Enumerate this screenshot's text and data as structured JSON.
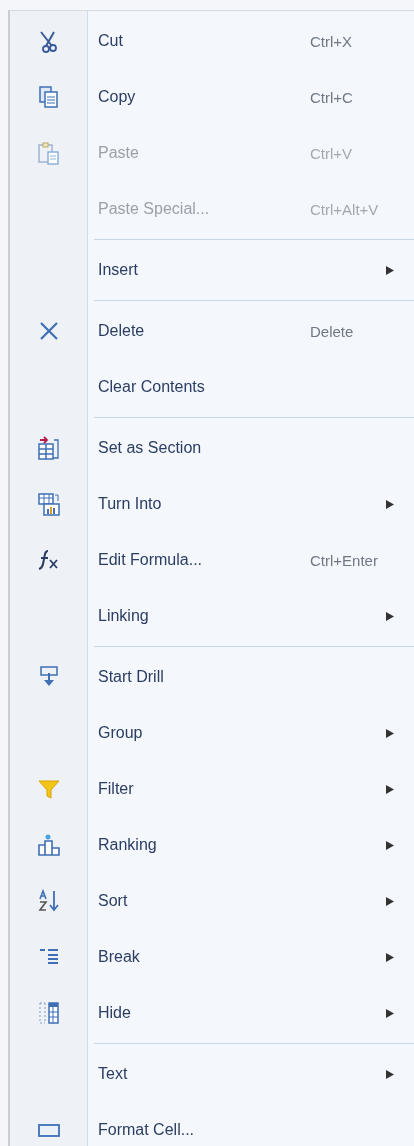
{
  "context_menu": {
    "groups": [
      {
        "items": [
          {
            "label": "Cut",
            "shortcut": "Ctrl+X",
            "disabled": false,
            "has_submenu": false
          },
          {
            "label": "Copy",
            "shortcut": "Ctrl+C",
            "disabled": false,
            "has_submenu": false
          },
          {
            "label": "Paste",
            "shortcut": "Ctrl+V",
            "disabled": true,
            "has_submenu": false
          },
          {
            "label": "Paste Special...",
            "shortcut": "Ctrl+Alt+V",
            "disabled": true,
            "has_submenu": false
          }
        ]
      },
      {
        "items": [
          {
            "label": "Insert",
            "disabled": false,
            "has_submenu": true
          }
        ]
      },
      {
        "items": [
          {
            "label": "Delete",
            "shortcut": "Delete",
            "disabled": false,
            "has_submenu": false
          },
          {
            "label": "Clear Contents",
            "disabled": false,
            "has_submenu": false
          }
        ]
      },
      {
        "items": [
          {
            "label": "Set as Section",
            "disabled": false,
            "has_submenu": false
          },
          {
            "label": "Turn Into",
            "disabled": false,
            "has_submenu": true
          },
          {
            "label": "Edit Formula...",
            "shortcut": "Ctrl+Enter",
            "disabled": false,
            "has_submenu": false
          },
          {
            "label": "Linking",
            "disabled": false,
            "has_submenu": true
          }
        ]
      },
      {
        "items": [
          {
            "label": "Start Drill",
            "disabled": false,
            "has_submenu": false
          },
          {
            "label": "Group",
            "disabled": false,
            "has_submenu": true
          },
          {
            "label": "Filter",
            "disabled": false,
            "has_submenu": true
          },
          {
            "label": "Ranking",
            "disabled": false,
            "has_submenu": true
          },
          {
            "label": "Sort",
            "disabled": false,
            "has_submenu": true
          },
          {
            "label": "Break",
            "disabled": false,
            "has_submenu": true
          },
          {
            "label": "Hide",
            "disabled": false,
            "has_submenu": true
          }
        ]
      },
      {
        "items": [
          {
            "label": "Text",
            "disabled": false,
            "has_submenu": true
          },
          {
            "label": "Format Cell...",
            "disabled": false,
            "has_submenu": false
          }
        ]
      }
    ]
  }
}
